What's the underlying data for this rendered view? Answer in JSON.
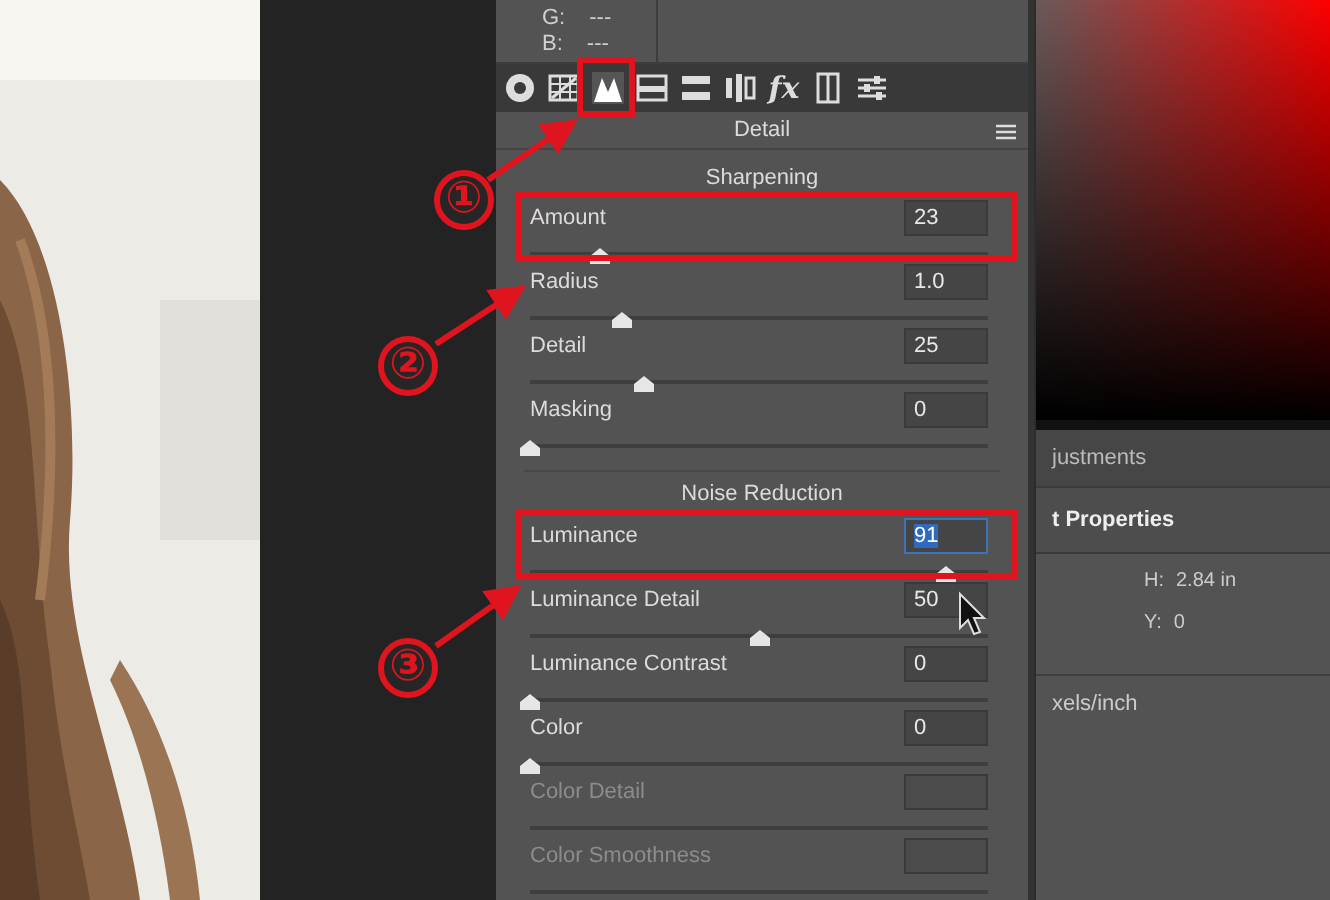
{
  "readouts": [
    {
      "label": "G:",
      "value": "---"
    },
    {
      "label": "B:",
      "value": "---"
    }
  ],
  "tool_icons": [
    {
      "selected": false
    },
    {
      "selected": false
    },
    {
      "selected": true
    },
    {
      "selected": false
    },
    {
      "selected": false
    },
    {
      "selected": false
    },
    {
      "selected": false,
      "label": "fx"
    },
    {
      "selected": false
    },
    {
      "selected": false
    }
  ],
  "panel_title": "Detail",
  "sections": [
    {
      "title": "Sharpening",
      "sliders": [
        {
          "label": "Amount",
          "value": "23",
          "level": 0.155,
          "disabled": false,
          "highlighted": false
        },
        {
          "label": "Radius",
          "value": "1.0",
          "level": 0.2,
          "disabled": false,
          "highlighted": false
        },
        {
          "label": "Detail",
          "value": "25",
          "level": 0.25,
          "disabled": false,
          "highlighted": false
        },
        {
          "label": "Masking",
          "value": "0",
          "level": 0,
          "disabled": false,
          "highlighted": false
        }
      ]
    },
    {
      "title": "Noise Reduction",
      "sliders": [
        {
          "label": "Luminance",
          "value": "91",
          "level": 0.91,
          "disabled": false,
          "highlighted": true
        },
        {
          "label": "Luminance Detail",
          "value": "50",
          "level": 0.5,
          "disabled": false,
          "highlighted": false
        },
        {
          "label": "Luminance Contrast",
          "value": "0",
          "level": 0,
          "disabled": false,
          "highlighted": false
        },
        {
          "label": "Color",
          "value": "0",
          "level": 0,
          "disabled": false,
          "highlighted": false
        },
        {
          "label": "Color Detail",
          "disabled": true,
          "highlighted": false
        },
        {
          "label": "Color Smoothness",
          "disabled": true,
          "highlighted": false
        }
      ]
    }
  ],
  "right_panel": {
    "tab": "justments",
    "header": "t Properties",
    "fields": [
      {
        "label": "H:",
        "value": "2.84 in"
      },
      {
        "label": "Y:",
        "value": "0"
      }
    ],
    "resolution_unit": "xels/inch"
  },
  "annotations": [
    {
      "label": "①"
    },
    {
      "label": "②"
    },
    {
      "label": "③"
    }
  ]
}
